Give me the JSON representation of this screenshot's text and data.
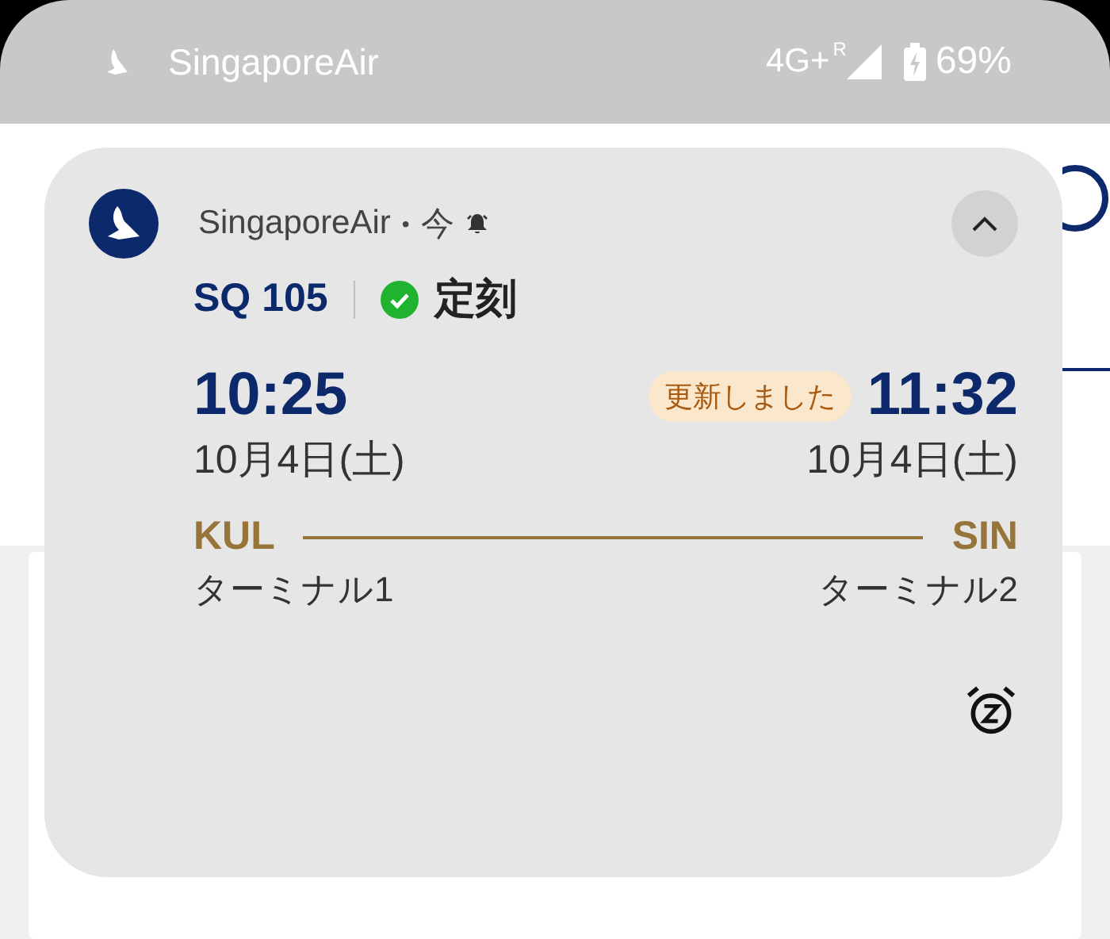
{
  "status_bar": {
    "app_name": "SingaporeAir",
    "network": "4G+",
    "roaming": "R",
    "battery": "69%"
  },
  "notification": {
    "app_name": "SingaporeAir",
    "separator": "•",
    "time": "今",
    "expanded": true,
    "flight": "SQ 105",
    "status": {
      "kind": "on_time",
      "label": "定刻"
    },
    "departure": {
      "time": "10:25",
      "date": "10月4日(土)",
      "airport": "KUL",
      "terminal": "ターミナル1"
    },
    "arrival": {
      "badge": "更新しました",
      "time": "11:32",
      "date": "10月4日(土)",
      "airport": "SIN",
      "terminal": "ターミナル2"
    }
  }
}
